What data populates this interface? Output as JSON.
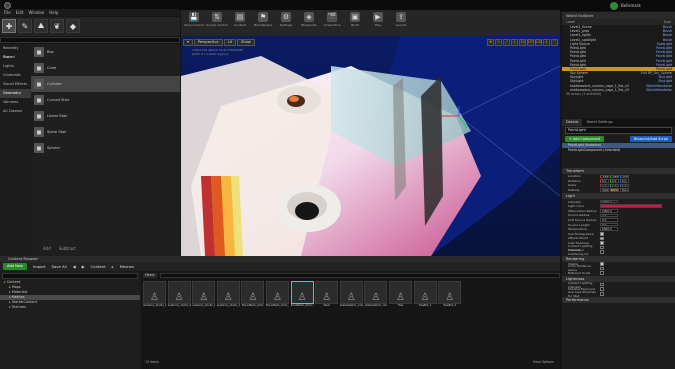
{
  "app": {
    "menu": [
      "File",
      "Edit",
      "Window",
      "Help"
    ],
    "top_right_label": "Bellsmark"
  },
  "modes": [
    {
      "icon": "place-mode-icon",
      "glyph": "✚"
    },
    {
      "icon": "paint-mode-icon",
      "glyph": "✎"
    },
    {
      "icon": "landscape-mode-icon",
      "glyph": "⛰"
    },
    {
      "icon": "foliage-mode-icon",
      "glyph": "❦"
    },
    {
      "icon": "geometry-mode-icon",
      "glyph": "◆"
    }
  ],
  "place": {
    "categories": [
      "Recently Placed",
      "Basic",
      "Lights",
      "Cinematic",
      "Visual Effects",
      "Geometry",
      "Volumes",
      "All Classes"
    ],
    "selected_category": "Geometry",
    "items": [
      "Box",
      "Cone",
      "Cylinder",
      "Curved Stair",
      "Linear Stair",
      "Spiral Stair",
      "Sphere"
    ],
    "selected_item": "Cylinder",
    "add_label": "Add",
    "subtract_label": "Subtract"
  },
  "toolbar": [
    "Save Current",
    "Source Control",
    "Content",
    "Marketplace",
    "Settings",
    "Blueprints",
    "Cinematics",
    "Build",
    "Play",
    "Launch"
  ],
  "viewport": {
    "perspective": "Perspective",
    "lit": "Lit",
    "show": "Show",
    "grid_snap": "10",
    "rot_snap": "10°",
    "scale_snap": "0.25",
    "cam_speed": "4",
    "stats": [
      "1280x720 480x3 74.42 PIXELSIZE",
      "JOINT 9 1 edadh aigirary"
    ]
  },
  "outliner": {
    "title": "World Outliner",
    "col_label": "Label",
    "col_type": "Type",
    "rows": [
      [
        "Level1_Scene",
        "Brush"
      ],
      [
        "Level1_prop",
        "Brush"
      ],
      [
        "Level1_lights",
        "Brush"
      ],
      [
        "Level1_spotlight",
        "Brush"
      ],
      [
        "Light Source",
        "SpotLight"
      ],
      [
        "PointLight",
        "PointLight"
      ],
      [
        "PointLight",
        "PointLight"
      ],
      [
        "PointLight",
        "PointLight"
      ],
      [
        "PointLight",
        "PointLight"
      ],
      [
        "PointLight",
        "PointLight"
      ],
      [
        "PointLight",
        "PointLight"
      ],
      [
        "Sky Sphere",
        "Edit BP_Sky_Sphere"
      ],
      [
        "SkyLight",
        "SkyLight"
      ],
      [
        "SkyLight",
        "SkyLight"
      ],
      [
        "shallowwbric_column_cage_1_fbx_v3",
        "StaticMeshActor"
      ],
      [
        "shallowwbric_column_cage_1_fbx_v3",
        "StaticMeshActor"
      ]
    ],
    "selected_index": 10,
    "footer": "36 actors (1 selected)"
  },
  "details": {
    "tabs": [
      "Details",
      "World Settings"
    ],
    "name": "PointLight",
    "add_component": "+ Add Component",
    "blueprint_btn": "Blueprint/Add Script",
    "components": [
      "PointLight (Instance)",
      "PointLightComponent (Inherited)"
    ],
    "transform_title": "Transform",
    "transform": [
      {
        "label": "Location",
        "vals": [
          "-588.0",
          "-885.0",
          "2740.0"
        ]
      },
      {
        "label": "Rotation",
        "vals": [
          "0.0",
          "0.0",
          "0.0"
        ]
      },
      {
        "label": "Scale",
        "vals": [
          "1.0",
          "1.0",
          "1.0"
        ]
      },
      {
        "label": "Mobility",
        "vals": [
          "Static",
          "Stationary",
          "Movable"
        ]
      }
    ],
    "light_title": "Light",
    "light": [
      {
        "label": "Intensity",
        "val": "5000.0"
      },
      {
        "label": "Light Color",
        "val": ""
      },
      {
        "label": "Attenuation Radius",
        "val": "1000.0"
      },
      {
        "label": "Source Radius",
        "val": "0.0"
      },
      {
        "label": "Soft Source Radius",
        "val": "0.0"
      },
      {
        "label": "Source Length",
        "val": "0.0"
      },
      {
        "label": "Temperature",
        "val": "6500.0"
      }
    ],
    "light_checks": [
      "Use Temperature",
      "Affects World",
      "Cast Shadows",
      "Indirect Lighting Intensity",
      "Volumetric Scattering Int"
    ],
    "rendering_title": "Rendering",
    "rendering": [
      "Visible",
      "Actor Hidden In Game",
      "Billboard Scale"
    ],
    "lightmass_title": "Lightmass",
    "lightmass": [
      "Indirect Lighting Intensity",
      "Shadow Exponent",
      "Use Area Shadows for Stat"
    ],
    "performance_title": "Performance"
  },
  "content_browser": {
    "title": "Content Browser",
    "add_new": "Add New",
    "import": "Import",
    "save_all": "Save All",
    "breadcrumb": [
      "Content",
      "Meshes"
    ],
    "tree": [
      "Content",
      "Maps",
      "Materials",
      "Meshes",
      "StarterContent",
      "Textures"
    ],
    "selected_tree": "Meshes",
    "filters_label": "Filters",
    "assets": [
      "anatomy_studio_body_01_body",
      "anatomy_studio_body_01_bottom",
      "anatomy_studio_body_01_bottom_1",
      "anatomy_studio_body_01_top",
      "BoneMesh_Actor",
      "BoneMesh_Actor_PhysicsAsset",
      "BoneMesh_Actor_Skeleton",
      "Stool",
      "shallowwbric_column_cage_1_fbx",
      "shallowwbric_column_cage_2_fbx",
      "Tree",
      "TreeBot_1",
      "TreeBot_2"
    ],
    "count": "13 items",
    "view_options": "View Options"
  }
}
